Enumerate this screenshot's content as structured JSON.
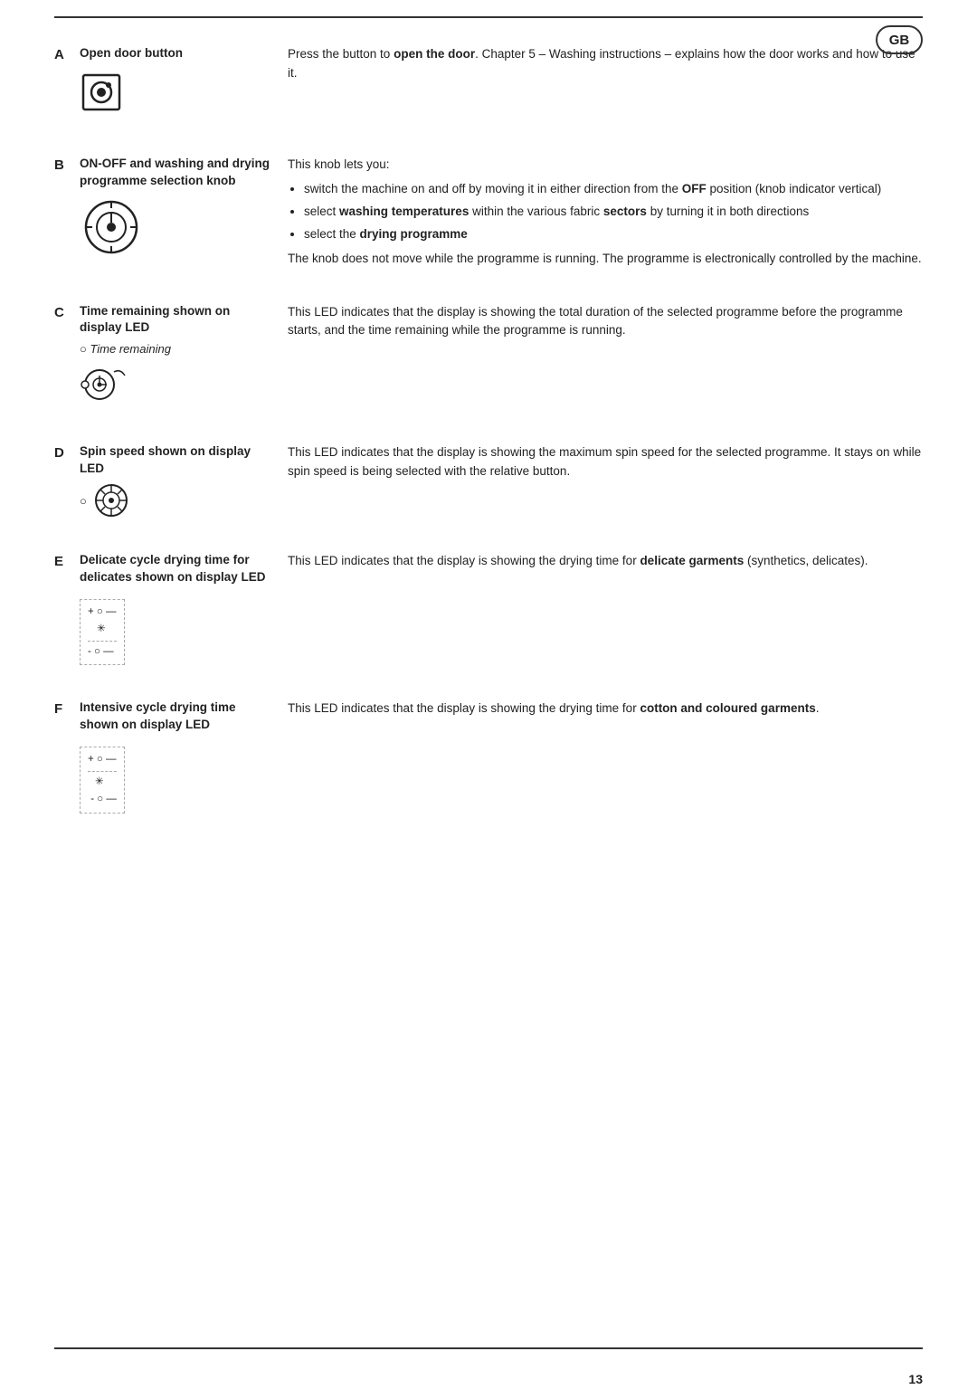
{
  "page": {
    "badge": "GB",
    "page_number": "13"
  },
  "rows": [
    {
      "letter": "A",
      "title": "Open door button",
      "icon_type": "door",
      "description_parts": [
        {
          "type": "text",
          "text": "Press the button to "
        },
        {
          "type": "bold",
          "text": "open the door"
        },
        {
          "type": "text",
          "text": ". Chapter 5 – Washing instructions – explains how the door works and how to use it."
        }
      ]
    },
    {
      "letter": "B",
      "title": "ON-OFF and washing and drying programme selection knob",
      "icon_type": "knob",
      "description_intro": "This knob lets you:",
      "description_bullets": [
        "switch the machine on and off by moving it in either direction from the OFF position (knob indicator vertical)",
        "select washing temperatures within the various fabric sectors by turning it in both directions",
        "select the drying programme"
      ],
      "description_footer": "The knob does not move while the programme is running. The programme is electronically controlled by the machine."
    },
    {
      "letter": "C",
      "title": "Time remaining shown on display LED",
      "italic_label": "Time remaining",
      "icon_type": "led_c",
      "description": "This LED indicates that the display is showing the total duration of the selected programme before the programme starts, and the time remaining while the programme is running."
    },
    {
      "letter": "D",
      "title": "Spin speed shown on display LED",
      "icon_type": "spin",
      "description": "This LED indicates that the display is showing the maximum spin speed for the selected programme. It stays on while spin speed is being selected with the relative button."
    },
    {
      "letter": "E",
      "title": "Delicate cycle drying time for delicates shown on display LED",
      "icon_type": "delicate_diagram",
      "description_parts": [
        {
          "type": "text",
          "text": "This LED indicates that the display is showing the drying time for "
        },
        {
          "type": "bold",
          "text": "delicate garments"
        },
        {
          "type": "text",
          "text": " (synthetics, delicates)."
        }
      ]
    },
    {
      "letter": "F",
      "title": "Intensive cycle drying time shown on display LED",
      "icon_type": "intensive_diagram",
      "description_parts": [
        {
          "type": "text",
          "text": "This LED indicates that the display is showing the drying time for "
        },
        {
          "type": "bold",
          "text": "cotton and coloured garments"
        },
        {
          "type": "text",
          "text": "."
        }
      ]
    }
  ]
}
